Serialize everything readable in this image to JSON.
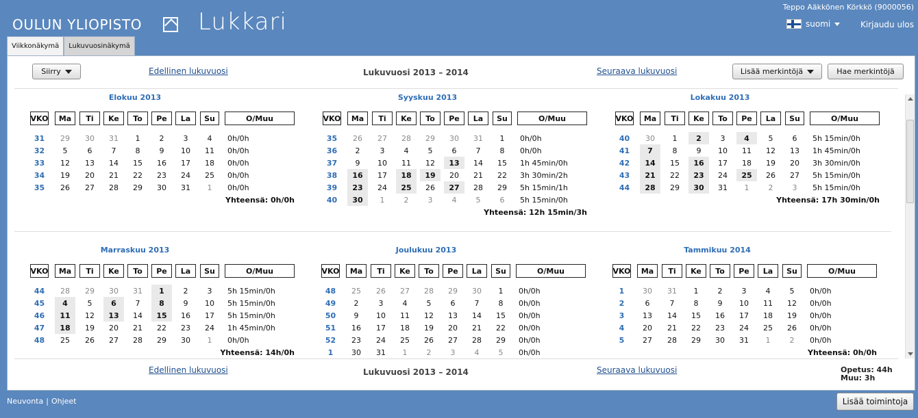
{
  "header": {
    "logo_text": "OULUN YLIOPISTO",
    "app_name": "Lukkari",
    "user_name": "Teppo Aäkkönen Körkkö (9000056)",
    "language": "suomi",
    "logout": "Kirjaudu ulos"
  },
  "tabs": [
    {
      "label": "Viikkonäkymä"
    },
    {
      "label": "Lukuvuosinäkymä"
    }
  ],
  "toolbar": {
    "goto": "Siirry",
    "prev_year": "Edellinen lukuvuosi",
    "year_title": "Lukuvuosi 2013 – 2014",
    "next_year": "Seuraava lukuvuosi",
    "add_marks": "Lisää merkintöjä",
    "find_marks": "Hae merkintöjä"
  },
  "calendar": {
    "headers": [
      "VKO",
      "Ma",
      "Ti",
      "Ke",
      "To",
      "Pe",
      "La",
      "Su",
      "O/Muu"
    ],
    "months": [
      {
        "title": "Elokuu 2013",
        "total": "Yhteensä: 0h/0h",
        "weeks": [
          {
            "wk": "31",
            "days": [
              {
                "d": "29",
                "o": 1
              },
              {
                "d": "30",
                "o": 1
              },
              {
                "d": "31",
                "o": 1
              },
              {
                "d": "1"
              },
              {
                "d": "2"
              },
              {
                "d": "3"
              },
              {
                "d": "4"
              }
            ],
            "sum": "0h/0h"
          },
          {
            "wk": "32",
            "days": [
              {
                "d": "5"
              },
              {
                "d": "6"
              },
              {
                "d": "7"
              },
              {
                "d": "8"
              },
              {
                "d": "9"
              },
              {
                "d": "10"
              },
              {
                "d": "11"
              }
            ],
            "sum": "0h/0h"
          },
          {
            "wk": "33",
            "days": [
              {
                "d": "12"
              },
              {
                "d": "13"
              },
              {
                "d": "14"
              },
              {
                "d": "15"
              },
              {
                "d": "16"
              },
              {
                "d": "17"
              },
              {
                "d": "18"
              }
            ],
            "sum": "0h/0h"
          },
          {
            "wk": "34",
            "days": [
              {
                "d": "19"
              },
              {
                "d": "20"
              },
              {
                "d": "21"
              },
              {
                "d": "22"
              },
              {
                "d": "23"
              },
              {
                "d": "24"
              },
              {
                "d": "25"
              }
            ],
            "sum": "0h/0h"
          },
          {
            "wk": "35",
            "days": [
              {
                "d": "26"
              },
              {
                "d": "27"
              },
              {
                "d": "28"
              },
              {
                "d": "29"
              },
              {
                "d": "30"
              },
              {
                "d": "31"
              },
              {
                "d": "1",
                "o": 1
              }
            ],
            "sum": "0h/0h"
          }
        ]
      },
      {
        "title": "Syyskuu 2013",
        "total": "Yhteensä: 12h 15min/3h",
        "weeks": [
          {
            "wk": "35",
            "days": [
              {
                "d": "26",
                "o": 1
              },
              {
                "d": "27",
                "o": 1
              },
              {
                "d": "28",
                "o": 1
              },
              {
                "d": "29",
                "o": 1
              },
              {
                "d": "30",
                "o": 1
              },
              {
                "d": "31",
                "o": 1
              },
              {
                "d": "1"
              }
            ],
            "sum": "0h/0h"
          },
          {
            "wk": "36",
            "days": [
              {
                "d": "2"
              },
              {
                "d": "3"
              },
              {
                "d": "4"
              },
              {
                "d": "5"
              },
              {
                "d": "6"
              },
              {
                "d": "7"
              },
              {
                "d": "8"
              }
            ],
            "sum": "0h/0h"
          },
          {
            "wk": "37",
            "days": [
              {
                "d": "9"
              },
              {
                "d": "10"
              },
              {
                "d": "11"
              },
              {
                "d": "12"
              },
              {
                "d": "13",
                "h": 1
              },
              {
                "d": "14"
              },
              {
                "d": "15"
              }
            ],
            "sum": "1h 45min/0h"
          },
          {
            "wk": "38",
            "days": [
              {
                "d": "16",
                "h": 1
              },
              {
                "d": "17"
              },
              {
                "d": "18",
                "h": 1
              },
              {
                "d": "19",
                "h": 1
              },
              {
                "d": "20"
              },
              {
                "d": "21"
              },
              {
                "d": "22"
              }
            ],
            "sum": "3h 30min/2h"
          },
          {
            "wk": "39",
            "days": [
              {
                "d": "23",
                "h": 1
              },
              {
                "d": "24"
              },
              {
                "d": "25",
                "h": 1
              },
              {
                "d": "26"
              },
              {
                "d": "27",
                "h": 1
              },
              {
                "d": "28"
              },
              {
                "d": "29"
              }
            ],
            "sum": "5h 15min/1h"
          },
          {
            "wk": "40",
            "days": [
              {
                "d": "30",
                "h": 1
              },
              {
                "d": "1",
                "o": 1
              },
              {
                "d": "2",
                "o": 1
              },
              {
                "d": "3",
                "o": 1
              },
              {
                "d": "4",
                "o": 1
              },
              {
                "d": "5",
                "o": 1
              },
              {
                "d": "6",
                "o": 1
              }
            ],
            "sum": "5h 15min/0h"
          }
        ]
      },
      {
        "title": "Lokakuu 2013",
        "total": "Yhteensä: 17h 30min/0h",
        "weeks": [
          {
            "wk": "40",
            "days": [
              {
                "d": "30",
                "o": 1
              },
              {
                "d": "1"
              },
              {
                "d": "2",
                "h": 1
              },
              {
                "d": "3"
              },
              {
                "d": "4",
                "h": 1
              },
              {
                "d": "5"
              },
              {
                "d": "6"
              }
            ],
            "sum": "5h 15min/0h"
          },
          {
            "wk": "41",
            "days": [
              {
                "d": "7",
                "h": 1
              },
              {
                "d": "8"
              },
              {
                "d": "9"
              },
              {
                "d": "10"
              },
              {
                "d": "11"
              },
              {
                "d": "12"
              },
              {
                "d": "13"
              }
            ],
            "sum": "1h 45min/0h"
          },
          {
            "wk": "42",
            "days": [
              {
                "d": "14",
                "h": 1
              },
              {
                "d": "15"
              },
              {
                "d": "16",
                "h": 1
              },
              {
                "d": "17"
              },
              {
                "d": "18"
              },
              {
                "d": "19"
              },
              {
                "d": "20"
              }
            ],
            "sum": "3h 30min/0h"
          },
          {
            "wk": "43",
            "days": [
              {
                "d": "21",
                "h": 1
              },
              {
                "d": "22"
              },
              {
                "d": "23",
                "h": 1
              },
              {
                "d": "24"
              },
              {
                "d": "25",
                "h": 1
              },
              {
                "d": "26"
              },
              {
                "d": "27"
              }
            ],
            "sum": "5h 15min/0h"
          },
          {
            "wk": "44",
            "days": [
              {
                "d": "28",
                "h": 1
              },
              {
                "d": "29"
              },
              {
                "d": "30",
                "h": 1
              },
              {
                "d": "31"
              },
              {
                "d": "1",
                "o": 1
              },
              {
                "d": "2",
                "o": 1
              },
              {
                "d": "3",
                "o": 1
              }
            ],
            "sum": "5h 15min/0h"
          }
        ]
      },
      {
        "title": "Marraskuu 2013",
        "total": "Yhteensä: 14h/0h",
        "weeks": [
          {
            "wk": "44",
            "days": [
              {
                "d": "28",
                "o": 1
              },
              {
                "d": "29",
                "o": 1
              },
              {
                "d": "30",
                "o": 1
              },
              {
                "d": "31",
                "o": 1
              },
              {
                "d": "1",
                "h": 1
              },
              {
                "d": "2"
              },
              {
                "d": "3"
              }
            ],
            "sum": "5h 15min/0h"
          },
          {
            "wk": "45",
            "days": [
              {
                "d": "4",
                "h": 1
              },
              {
                "d": "5"
              },
              {
                "d": "6",
                "h": 1
              },
              {
                "d": "7"
              },
              {
                "d": "8",
                "h": 1
              },
              {
                "d": "9"
              },
              {
                "d": "10"
              }
            ],
            "sum": "5h 15min/0h"
          },
          {
            "wk": "46",
            "days": [
              {
                "d": "11",
                "h": 1
              },
              {
                "d": "12"
              },
              {
                "d": "13",
                "h": 1
              },
              {
                "d": "14"
              },
              {
                "d": "15",
                "h": 1
              },
              {
                "d": "16"
              },
              {
                "d": "17"
              }
            ],
            "sum": "5h 15min/0h"
          },
          {
            "wk": "47",
            "days": [
              {
                "d": "18",
                "h": 1
              },
              {
                "d": "19"
              },
              {
                "d": "20"
              },
              {
                "d": "21"
              },
              {
                "d": "22"
              },
              {
                "d": "23"
              },
              {
                "d": "24"
              }
            ],
            "sum": "1h 45min/0h"
          },
          {
            "wk": "48",
            "days": [
              {
                "d": "25"
              },
              {
                "d": "26"
              },
              {
                "d": "27"
              },
              {
                "d": "28"
              },
              {
                "d": "29"
              },
              {
                "d": "30"
              },
              {
                "d": "1",
                "o": 1
              }
            ],
            "sum": "0h/0h"
          }
        ]
      },
      {
        "title": "Joulukuu 2013",
        "total": "",
        "weeks": [
          {
            "wk": "48",
            "days": [
              {
                "d": "25",
                "o": 1
              },
              {
                "d": "26",
                "o": 1
              },
              {
                "d": "27",
                "o": 1
              },
              {
                "d": "28",
                "o": 1
              },
              {
                "d": "29",
                "o": 1
              },
              {
                "d": "30",
                "o": 1
              },
              {
                "d": "1"
              }
            ],
            "sum": "0h/0h"
          },
          {
            "wk": "49",
            "days": [
              {
                "d": "2"
              },
              {
                "d": "3"
              },
              {
                "d": "4"
              },
              {
                "d": "5"
              },
              {
                "d": "6"
              },
              {
                "d": "7"
              },
              {
                "d": "8"
              }
            ],
            "sum": "0h/0h"
          },
          {
            "wk": "50",
            "days": [
              {
                "d": "9"
              },
              {
                "d": "10"
              },
              {
                "d": "11"
              },
              {
                "d": "12"
              },
              {
                "d": "13"
              },
              {
                "d": "14"
              },
              {
                "d": "15"
              }
            ],
            "sum": "0h/0h"
          },
          {
            "wk": "51",
            "days": [
              {
                "d": "16"
              },
              {
                "d": "17"
              },
              {
                "d": "18"
              },
              {
                "d": "19"
              },
              {
                "d": "20"
              },
              {
                "d": "21"
              },
              {
                "d": "22"
              }
            ],
            "sum": "0h/0h"
          },
          {
            "wk": "52",
            "days": [
              {
                "d": "23"
              },
              {
                "d": "24"
              },
              {
                "d": "25"
              },
              {
                "d": "26"
              },
              {
                "d": "27"
              },
              {
                "d": "28"
              },
              {
                "d": "29"
              }
            ],
            "sum": "0h/0h"
          },
          {
            "wk": "1",
            "days": [
              {
                "d": "30"
              },
              {
                "d": "31"
              },
              {
                "d": "1",
                "o": 1
              },
              {
                "d": "2",
                "o": 1
              },
              {
                "d": "3",
                "o": 1
              },
              {
                "d": "4",
                "o": 1
              },
              {
                "d": "5",
                "o": 1
              }
            ],
            "sum": "0h/0h"
          }
        ]
      },
      {
        "title": "Tammikuu 2014",
        "total": "Yhteensä: 0h/0h",
        "weeks": [
          {
            "wk": "1",
            "days": [
              {
                "d": "30",
                "o": 1
              },
              {
                "d": "31",
                "o": 1
              },
              {
                "d": "1"
              },
              {
                "d": "2"
              },
              {
                "d": "3"
              },
              {
                "d": "4"
              },
              {
                "d": "5"
              }
            ],
            "sum": "0h/0h"
          },
          {
            "wk": "2",
            "days": [
              {
                "d": "6"
              },
              {
                "d": "7"
              },
              {
                "d": "8"
              },
              {
                "d": "9"
              },
              {
                "d": "10"
              },
              {
                "d": "11"
              },
              {
                "d": "12"
              }
            ],
            "sum": "0h/0h"
          },
          {
            "wk": "3",
            "days": [
              {
                "d": "13"
              },
              {
                "d": "14"
              },
              {
                "d": "15"
              },
              {
                "d": "16"
              },
              {
                "d": "17"
              },
              {
                "d": "18"
              },
              {
                "d": "19"
              }
            ],
            "sum": "0h/0h"
          },
          {
            "wk": "4",
            "days": [
              {
                "d": "20"
              },
              {
                "d": "21"
              },
              {
                "d": "22"
              },
              {
                "d": "23"
              },
              {
                "d": "24"
              },
              {
                "d": "25"
              },
              {
                "d": "26"
              }
            ],
            "sum": "0h/0h"
          },
          {
            "wk": "5",
            "days": [
              {
                "d": "27"
              },
              {
                "d": "28"
              },
              {
                "d": "29"
              },
              {
                "d": "30"
              },
              {
                "d": "31"
              },
              {
                "d": "1",
                "o": 1
              },
              {
                "d": "2",
                "o": 1
              }
            ],
            "sum": "0h/0h"
          }
        ]
      }
    ]
  },
  "summary": {
    "opetus": "Opetus: 44h",
    "muu": "Muu: 3h"
  },
  "footer": {
    "advice": "Neuvonta",
    "separator": "|",
    "help": "Ohjeet",
    "add_actions": "Lisää toimintoja"
  }
}
